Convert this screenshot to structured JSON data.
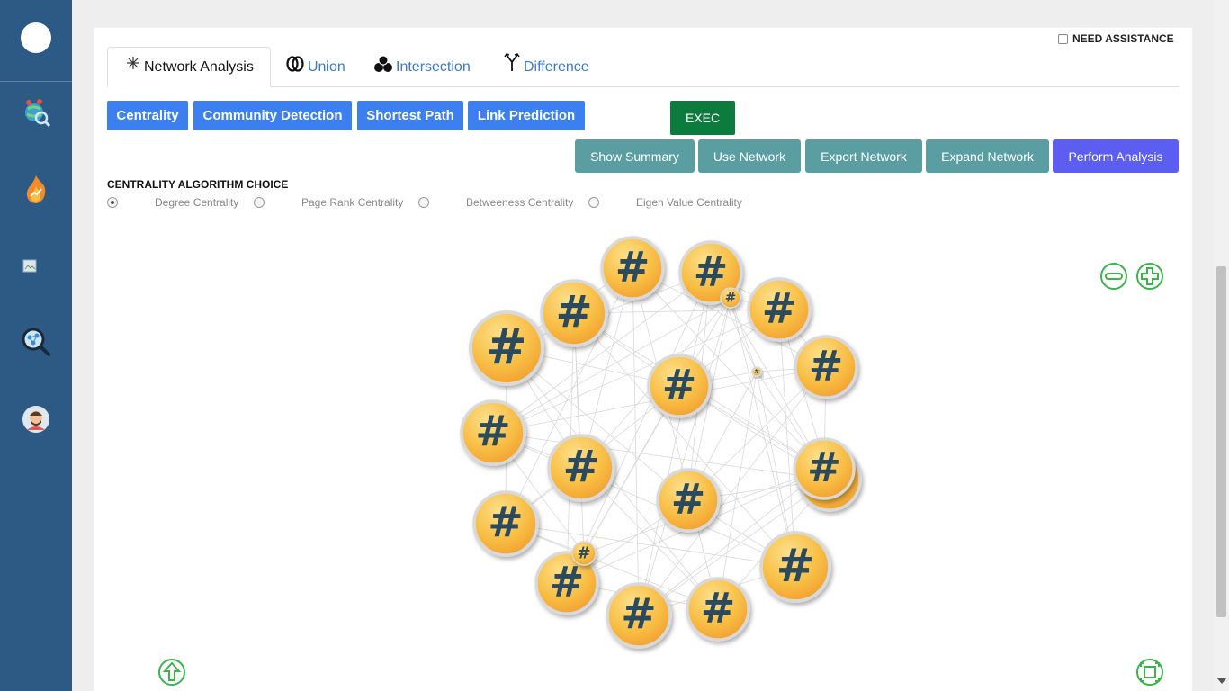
{
  "sidebar": {
    "items": [
      {
        "name": "logo",
        "icon": "logo-icon"
      },
      {
        "name": "network-explore",
        "icon": "globe-network-icon"
      },
      {
        "name": "trending",
        "icon": "fire-trend-icon"
      },
      {
        "name": "image-placeholder",
        "icon": "broken-image-icon"
      },
      {
        "name": "network-search",
        "icon": "graph-search-icon"
      },
      {
        "name": "profile",
        "icon": "avatar-icon"
      }
    ]
  },
  "assistance": {
    "label": "NEED ASSISTANCE",
    "checked": false
  },
  "tabs": [
    {
      "label": "Network Analysis",
      "icon": "asterisk-icon",
      "active": true
    },
    {
      "label": "Union",
      "icon": "rings-icon",
      "active": false
    },
    {
      "label": "Intersection",
      "icon": "circles-cluster-icon",
      "active": false
    },
    {
      "label": "Difference",
      "icon": "fork-icon",
      "active": false
    }
  ],
  "analysis_buttons": [
    {
      "label": "Centrality"
    },
    {
      "label": "Community Detection"
    },
    {
      "label": "Shortest Path"
    },
    {
      "label": "Link Prediction"
    }
  ],
  "exec_label": "EXEC",
  "action_buttons": [
    {
      "label": "Show Summary"
    },
    {
      "label": "Use Network"
    },
    {
      "label": "Export Network"
    },
    {
      "label": "Expand Network"
    },
    {
      "label": "Perform Analysis"
    }
  ],
  "algorithm": {
    "title": "CENTRALITY ALGORITHM CHOICE",
    "options": [
      {
        "label": "Degree Centrality",
        "selected": true
      },
      {
        "label": "Page Rank Centrality",
        "selected": false
      },
      {
        "label": "Betweeness Centrality",
        "selected": false
      },
      {
        "label": "Eigen Value Centrality",
        "selected": false
      }
    ]
  },
  "graph": {
    "node_symbol": "#",
    "node_color": "#f6b73c",
    "symbol_color": "#2b4a5e",
    "nodes": 21
  },
  "controls": {
    "zoom_out": "zoom-out-icon",
    "zoom_in": "zoom-in-icon",
    "scroll_top": "arrow-up-icon",
    "fit": "fit-screen-icon"
  },
  "colors": {
    "sidebar": "#2d5a85",
    "primary": "#3b7ff0",
    "exec": "#0d7a3e",
    "teal": "#5b9ea1",
    "perform": "#5b5ef0",
    "control_green": "#3cb44b"
  }
}
